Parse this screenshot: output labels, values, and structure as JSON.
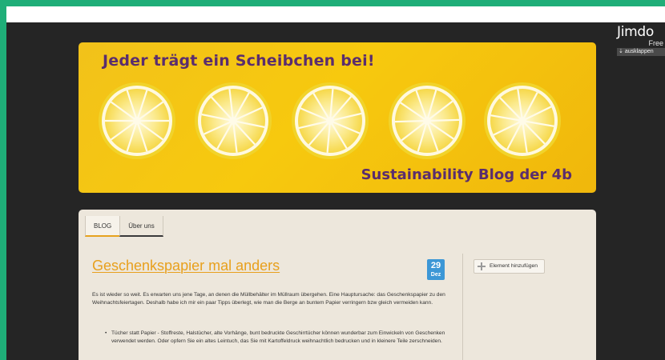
{
  "jimdo": {
    "logo_text": "Jimdo",
    "plan": "Free",
    "expand_label": "ausklappen"
  },
  "banner": {
    "title": "Jeder trägt ein Scheibchen bei!",
    "subtitle": "Sustainability Blog der 4b"
  },
  "nav": {
    "tabs": [
      {
        "label": "BLOG"
      },
      {
        "label": "Über uns"
      }
    ]
  },
  "post": {
    "title": "Geschenkspapier mal anders",
    "date_day": "29",
    "date_month": "Dez",
    "intro": "Es ist wieder so weit. Es erwarten uns jene Tage, an denen die Müllbehälter im Müllraum übergehen. Eine Hauptursache: das Geschenkspapier zu den Weihnachtsfeiertagen. Deshalb habe ich mir ein paar Tipps überlegt, wie man die Berge an buntem Papier verringern bzw gleich vermeiden kann.",
    "bullets": [
      "Tücher statt Papier - Stoffreste, Halstücher, alte Vorhänge, bunt bedruckte Geschirrtücher können wunderbar zum Einwickeln von Geschenken verwendet werden. Oder opfern Sie ein altes Leintuch, das Sie mit Kartoffeldruck weihnachtlich bedrucken und in kleinere Teile zerschneiden."
    ]
  },
  "sidebar": {
    "add_element_label": "Element hinzufügen"
  },
  "colors": {
    "accent": "#e8a01d",
    "banner_text": "#5a2d6e",
    "date_badge": "#3c97d6",
    "frame": "#1fae78"
  }
}
